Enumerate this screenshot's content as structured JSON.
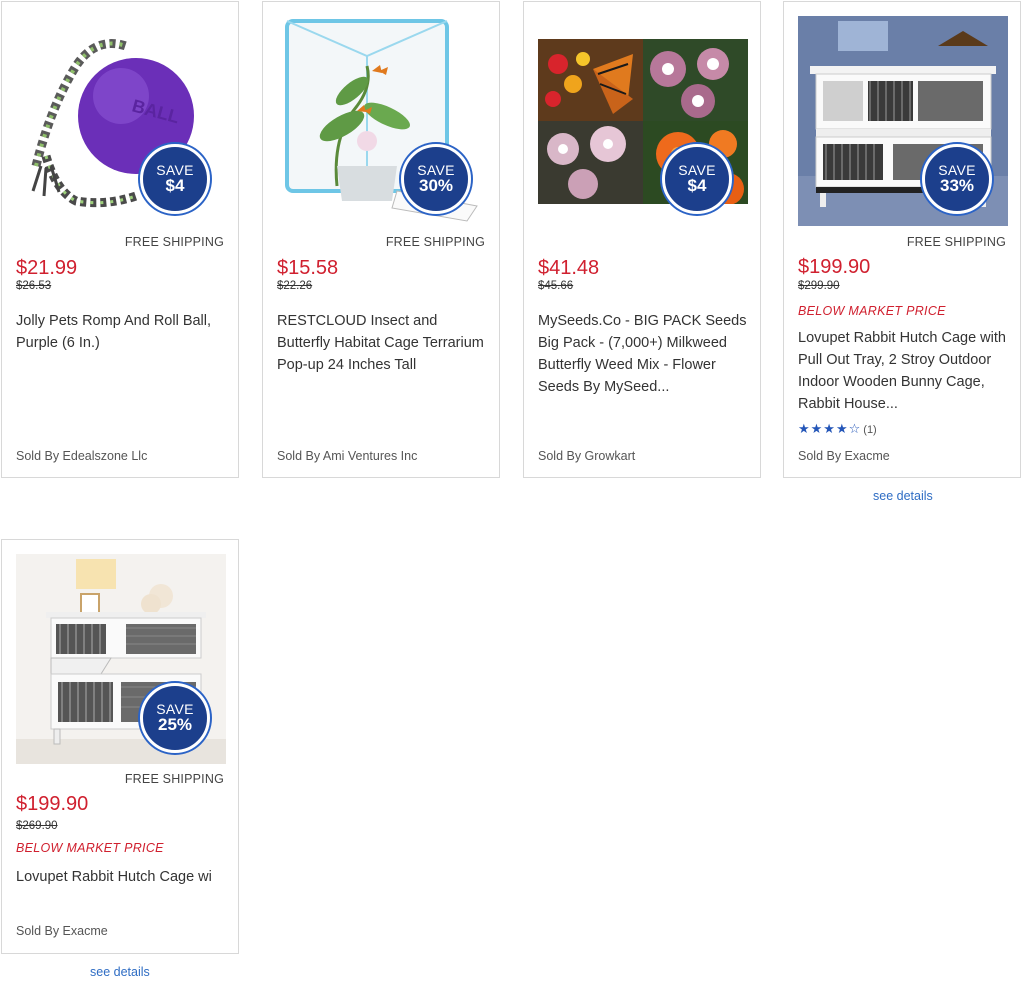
{
  "products": [
    {
      "save_word": "SAVE",
      "save_amount": "$4",
      "shipping": "FREE SHIPPING",
      "price": "$21.99",
      "was_price": "$26.53",
      "title": "Jolly Pets Romp And Roll Ball, Purple (6 In.)",
      "seller": "Sold By Edealszone Llc",
      "image_icon": "purple-ball-toy-image"
    },
    {
      "save_word": "SAVE",
      "save_amount": "30%",
      "shipping": "FREE SHIPPING",
      "price": "$15.58",
      "was_price": "$22.26",
      "title": "RESTCLOUD Insect and Butterfly Habitat Cage Terrarium Pop-up 24 Inches Tall",
      "seller": "Sold By Ami Ventures Inc",
      "image_icon": "butterfly-cage-image"
    },
    {
      "save_word": "SAVE",
      "save_amount": "$4",
      "price": "$41.48",
      "was_price": "$45.66",
      "title": "MySeeds.Co - BIG PACK Seeds Big Pack - (7,000+) Milkweed Butterfly Weed Mix - Flower Seeds By MySeed...",
      "seller": "Sold By Growkart",
      "image_icon": "milkweed-flowers-image"
    },
    {
      "save_word": "SAVE",
      "save_amount": "33%",
      "shipping": "FREE SHIPPING",
      "price": "$199.90",
      "was_price": "$299.90",
      "below_market": "BELOW MARKET PRICE",
      "title": "Lovupet Rabbit Hutch Cage with Pull Out Tray, 2 Stroy Outdoor Indoor Wooden Bunny Cage, Rabbit House...",
      "rating_stars": "★★★★☆",
      "rating": 4,
      "rating_count": "(1)",
      "seller": "Sold By Exacme",
      "details_link": "see details",
      "image_icon": "rabbit-hutch-image"
    },
    {
      "save_word": "SAVE",
      "save_amount": "25%",
      "shipping": "FREE SHIPPING",
      "price": "$199.90",
      "was_price": "$269.90",
      "below_market": "BELOW MARKET PRICE",
      "title": "Lovupet Rabbit Hutch Cage wi",
      "seller": "Sold By Exacme",
      "details_link": "see details",
      "image_icon": "rabbit-hutch-image"
    }
  ],
  "colors": {
    "price_red": "#d0202f",
    "badge_blue": "#1c3f8c",
    "link_blue": "#2f6dc4",
    "star_blue": "#2456b8"
  }
}
